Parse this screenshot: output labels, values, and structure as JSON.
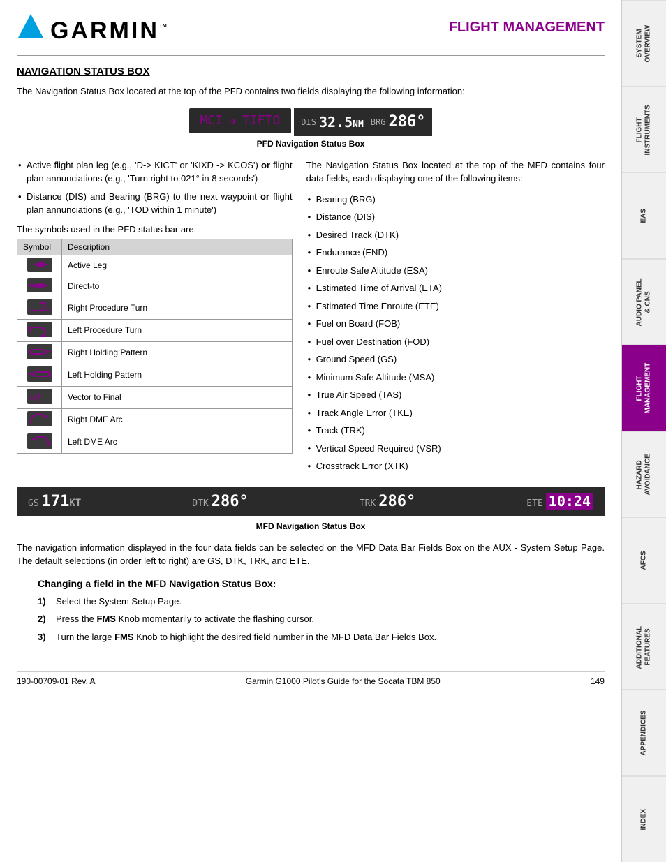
{
  "header": {
    "logo_text": "GARMIN",
    "title": "FLIGHT MANAGEMENT"
  },
  "section": {
    "heading": "NAVIGATION STATUS BOX",
    "intro": "The Navigation Status Box located at the top of the PFD contains two fields displaying the following information:",
    "pfd_label": "MCI",
    "pfd_arrow": "→",
    "pfd_dest": "TIFTO",
    "pfd_dis_label": "DIS",
    "pfd_dis_val": "32.5",
    "pfd_dis_unit": "NM",
    "pfd_brg_label": "BRG",
    "pfd_brg_val": "286°",
    "pfd_caption": "PFD Navigation Status Box"
  },
  "left_bullets": [
    {
      "text_parts": [
        {
          "text": "Active flight plan leg (e.g., 'D-> KICT' or 'KIXD -> KCOS') ",
          "bold": false
        },
        {
          "text": "or",
          "bold": true
        },
        {
          "text": " flight plan annunciations (e.g., 'Turn right to 021° in 8 seconds')",
          "bold": false
        }
      ]
    },
    {
      "text_parts": [
        {
          "text": "Distance (DIS) and Bearing (BRG) to the next waypoint ",
          "bold": false
        },
        {
          "text": "or",
          "bold": true
        },
        {
          "text": " flight plan annunciations (e.g., 'TOD within 1 minute')",
          "bold": false
        }
      ]
    }
  ],
  "symbols_note": "The symbols used in the PFD status bar are:",
  "symbols_table": {
    "col1": "Symbol",
    "col2": "Description",
    "rows": [
      {
        "symbol": "arrow",
        "desc": "Active Leg"
      },
      {
        "symbol": "direct",
        "desc": "Direct-to"
      },
      {
        "symbol": "rpt",
        "desc": "Right Procedure Turn"
      },
      {
        "symbol": "lpt",
        "desc": "Left Procedure Turn"
      },
      {
        "symbol": "rhp",
        "desc": "Right Holding Pattern"
      },
      {
        "symbol": "lhp",
        "desc": "Left Holding Pattern"
      },
      {
        "symbol": "vtf",
        "desc": "Vector to Final"
      },
      {
        "symbol": "rdme",
        "desc": "Right DME Arc"
      },
      {
        "symbol": "ldme",
        "desc": "Left DME Arc"
      }
    ]
  },
  "right_bullets": [
    "The Navigation Status Box located at the top of the MFD contains four data fields, each displaying one of the following items:",
    "Bearing (BRG)",
    "Distance (DIS)",
    "Desired Track (DTK)",
    "Endurance (END)",
    "Enroute Safe Altitude (ESA)",
    "Estimated Time of Arrival (ETA)",
    "Estimated Time Enroute (ETE)",
    "Fuel on Board (FOB)",
    "Fuel over Destination (FOD)",
    "Ground Speed (GS)",
    "Minimum Safe Altitude (MSA)",
    "True Air Speed (TAS)",
    "Track Angle Error (TKE)",
    "Track (TRK)",
    "Vertical Speed Required (VSR)",
    "Crosstrack Error (XTK)"
  ],
  "mfd_fields": [
    {
      "label": "GS",
      "value": "171",
      "unit": "KT"
    },
    {
      "label": "DTK",
      "value": "286°",
      "unit": ""
    },
    {
      "label": "TRK",
      "value": "286°",
      "unit": ""
    },
    {
      "label": "ETE",
      "value": "10:24",
      "highlight": true
    }
  ],
  "mfd_caption": "MFD Navigation Status Box",
  "bottom_para": "The navigation information displayed in the four data fields can be selected on the MFD Data Bar Fields Box on the AUX - System Setup Page.  The default selections (in order left to right) are GS, DTK, TRK, and ETE.",
  "changing_heading": "Changing a field in the MFD Navigation Status Box:",
  "steps": [
    {
      "num": "1)",
      "text_parts": [
        {
          "text": "Select the System Setup Page.",
          "bold": false
        }
      ]
    },
    {
      "num": "2)",
      "text_parts": [
        {
          "text": "Press the ",
          "bold": false
        },
        {
          "text": "FMS",
          "bold": true
        },
        {
          "text": " Knob momentarily to activate the flashing cursor.",
          "bold": false
        }
      ]
    },
    {
      "num": "3)",
      "text_parts": [
        {
          "text": "Turn the large ",
          "bold": false
        },
        {
          "text": "FMS",
          "bold": true
        },
        {
          "text": " Knob to highlight the desired field number in the MFD Data Bar Fields Box.",
          "bold": false
        }
      ]
    }
  ],
  "footer": {
    "left": "190-00709-01  Rev. A",
    "center": "Garmin G1000 Pilot's Guide for the Socata TBM 850",
    "right": "149"
  },
  "sidebar_tabs": [
    {
      "label": "SYSTEM\nOVERVIEW",
      "active": false
    },
    {
      "label": "FLIGHT\nINSTRUMENTS",
      "active": false
    },
    {
      "label": "EAS",
      "active": false
    },
    {
      "label": "AUDIO PANEL\n& CNS",
      "active": false
    },
    {
      "label": "FLIGHT\nMANAGEMENT",
      "active": true
    },
    {
      "label": "HAZARD\nAVOIDANCE",
      "active": false
    },
    {
      "label": "AFCS",
      "active": false
    },
    {
      "label": "ADDITIONAL\nFEATURES",
      "active": false
    },
    {
      "label": "APPENDICES",
      "active": false
    },
    {
      "label": "INDEX",
      "active": false
    }
  ]
}
